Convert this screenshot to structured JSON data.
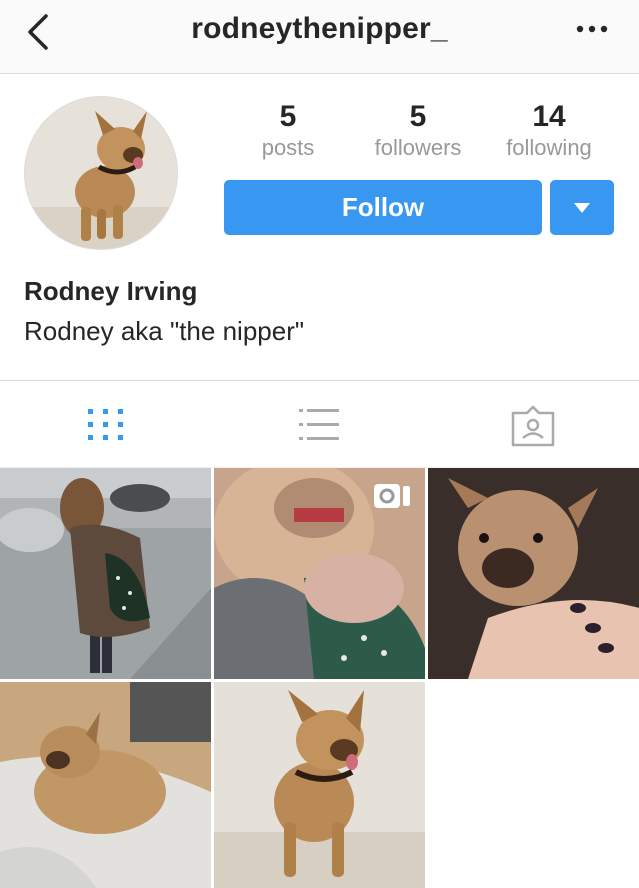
{
  "header": {
    "username": "rodneythenipper_",
    "back_icon": "chevron-left-icon",
    "more_icon": "more-dots-icon"
  },
  "profile": {
    "stats": {
      "posts": {
        "value": "5",
        "label": "posts"
      },
      "followers": {
        "value": "5",
        "label": "followers"
      },
      "following": {
        "value": "14",
        "label": "following"
      }
    },
    "follow_label": "Follow",
    "full_name": "Rodney Irving",
    "bio": "Rodney aka \"the nipper\""
  },
  "tabs": [
    {
      "name": "grid-view",
      "icon": "grid-icon",
      "active": true
    },
    {
      "name": "list-view",
      "icon": "list-icon",
      "active": false
    },
    {
      "name": "tagged",
      "icon": "tagged-icon",
      "active": false
    }
  ],
  "posts": [
    {
      "subject": "woman holding puppy on street",
      "video": false
    },
    {
      "subject": "puppy close-up",
      "video": true
    },
    {
      "subject": "puppy in hands",
      "video": false
    },
    {
      "subject": "puppy sleeping on blanket",
      "video": false
    },
    {
      "subject": "french bulldog standing",
      "video": false
    }
  ],
  "colors": {
    "accent": "#3897f0",
    "text": "#262626",
    "muted": "#999999",
    "border": "#dbdbdb"
  }
}
